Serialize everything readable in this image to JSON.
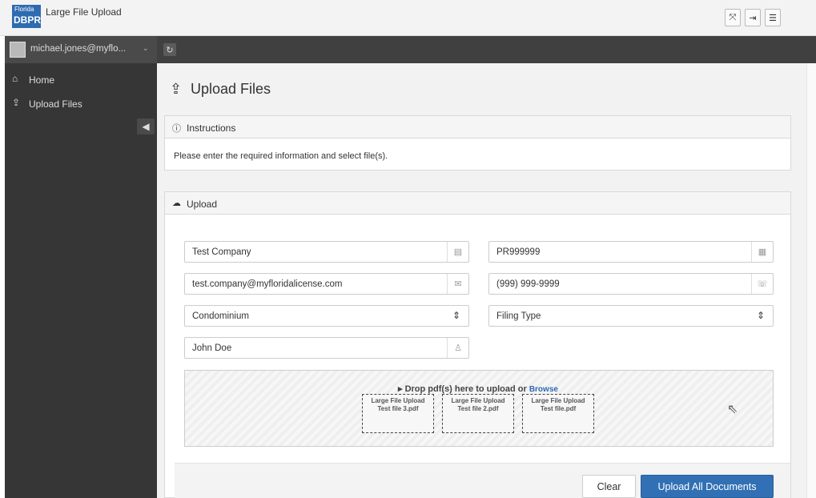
{
  "app": {
    "logo_line1": "Florida",
    "logo_line2": "DBPR",
    "title": "Large File Upload"
  },
  "topbar": {
    "fullscreen_icon": "expand-icon",
    "logout_icon": "sign-out-icon",
    "menu_icon": "hamburger-icon"
  },
  "sidebar": {
    "user": "michael.jones@myflo...",
    "items": [
      {
        "label": "Home",
        "icon": "home-icon"
      },
      {
        "label": "Upload Files",
        "icon": "upload-icon"
      }
    ]
  },
  "page": {
    "title": "Upload Files"
  },
  "instructions": {
    "heading": "Instructions",
    "text": "Please enter the required information and select file(s)."
  },
  "upload": {
    "heading": "Upload",
    "company": "Test Company",
    "license": "PR999999",
    "email": "test.company@myfloridalicense.com",
    "phone": "(999) 999-9999",
    "category": "Condominium",
    "filing_type": "Filing Type",
    "contact": "John Doe",
    "drop_text": "Drop pdf(s) here to upload or",
    "browse": "Browse",
    "files": [
      {
        "line1": "Large File Upload",
        "line2": "Test file 3.pdf"
      },
      {
        "line1": "Large File Upload",
        "line2": "Test file 2.pdf"
      },
      {
        "line1": "Large File Upload",
        "line2": "Test file.pdf"
      }
    ],
    "clear_label": "Clear",
    "submit_label": "Upload All Documents"
  },
  "colors": {
    "primary": "#3170b4",
    "sidebar": "#363636",
    "logo": "#2e6bb0"
  }
}
